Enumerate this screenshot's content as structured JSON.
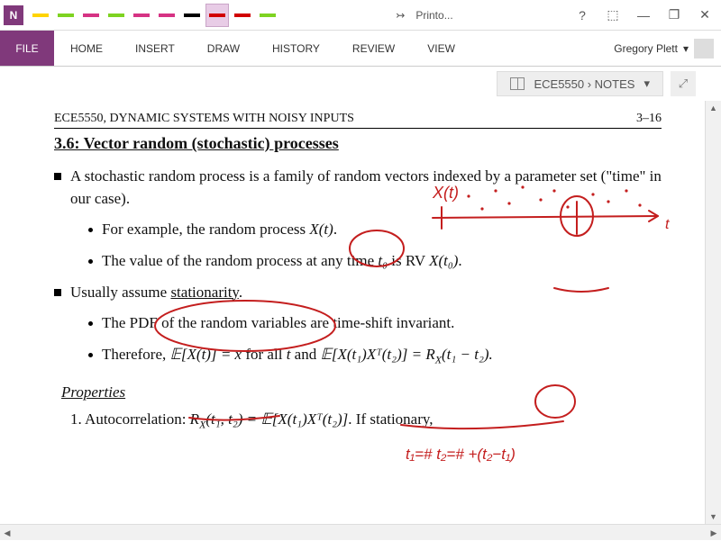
{
  "app": {
    "icon_letter": "N"
  },
  "pens": [
    {
      "color": "#ffd400",
      "selected": false
    },
    {
      "color": "#7ed321",
      "selected": false
    },
    {
      "color": "#d63384",
      "selected": false
    },
    {
      "color": "#7ed321",
      "selected": false
    },
    {
      "color": "#d63384",
      "selected": false
    },
    {
      "color": "#d63384",
      "selected": false
    },
    {
      "color": "#000000",
      "selected": false
    },
    {
      "color": "#d10000",
      "selected": true
    },
    {
      "color": "#d10000",
      "selected": false
    },
    {
      "color": "#7ed321",
      "selected": false
    }
  ],
  "title_bar": {
    "overflow_glyph": "↣",
    "doc_label": "Printo...",
    "help_glyph": "?",
    "touch_glyph": "⬚",
    "min_glyph": "—",
    "restore_glyph": "❐",
    "close_glyph": "✕"
  },
  "tabs": {
    "file": "FILE",
    "items": [
      "HOME",
      "INSERT",
      "DRAW",
      "HISTORY",
      "REVIEW",
      "VIEW"
    ]
  },
  "user": {
    "name": "Gregory Plett",
    "caret": "▾"
  },
  "breadcrumb": {
    "text": "ECE5550  ›  NOTES",
    "caret": "▾",
    "expand_glyph": "⤢"
  },
  "doc": {
    "header_left": "ECE5550, DYNAMIC SYSTEMS WITH NOISY INPUTS",
    "header_right": "3–16",
    "title": "3.6: Vector random (stochastic) processes",
    "b1": "A stochastic random process is a family of random vectors indexed by a parameter set (\"time\" in our case).",
    "b1a_pre": "For example, the random process ",
    "b1a_math": "X(t)",
    "b1a_post": ".",
    "b1b_pre": "The value of the random process at any time ",
    "b1b_m1": "t₀",
    "b1b_mid": " is RV ",
    "b1b_m2": "X(t₀)",
    "b1b_post": ".",
    "b2_pre": "Usually assume ",
    "b2_u": "stationarity",
    "b2_post": ".",
    "b2a": "The PDF of the random variables are time-shift invariant.",
    "b2b_pre": "Therefore, ",
    "b2b_m1": "𝔼[X(t)] = x̄",
    "b2b_mid1": " for all ",
    "b2b_m2": "t",
    "b2b_mid2": " and ",
    "b2b_m3": "𝔼[X(t₁)Xᵀ(t₂)] = R",
    "b2b_m3b": "X",
    "b2b_m3c": "(t₁ − t₂).",
    "props": "Properties",
    "n1_pre": "1. Autocorrelation: ",
    "n1_m": "R",
    "n1_mb": "X",
    "n1_mc": "(t₁, t₂) = 𝔼[X(t₁)Xᵀ(t₂)]",
    "n1_post": ". If stationary,"
  },
  "ink": {
    "color": "#c41e1e",
    "xlt_label": "X(t)",
    "t_label": "t",
    "props_note": "t₁=#   t₂=# +(t₂−t₁)"
  },
  "scroll": {
    "up": "▲",
    "down": "▼",
    "left": "◀",
    "right": "▶"
  }
}
